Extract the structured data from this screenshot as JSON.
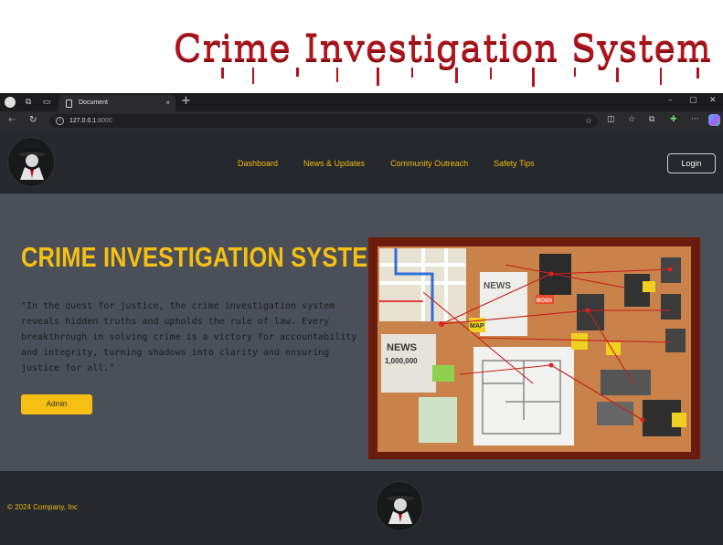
{
  "banner": {
    "title": "Crime Investigation System"
  },
  "browser": {
    "tab_title": "Document",
    "tab_close": "×",
    "new_tab": "+",
    "url_host": "127.0.0.1",
    "url_port": ":8000",
    "window_controls": [
      "–",
      "▢",
      "✕"
    ]
  },
  "site": {
    "nav": [
      "Dashboard",
      "News & Updates",
      "Community Outreach",
      "Safety Tips"
    ],
    "login_label": "Login",
    "hero_title": "CRIME INVESTIGATION SYSTEM",
    "hero_text": "\"In the quest for justice, the crime investigation system reveals hidden truths and upholds the rule of law. Every breakthrough in solving crime is a victory for accountability and integrity, turning shadows into clarity and ensuring justice for all.\"",
    "admin_label": "Admin",
    "footer_copyright": "© 2024 Company, Inc"
  },
  "board_labels": {
    "news": "NEWS",
    "stolen": "1,000,000",
    "map": "MAP",
    "boss": "BOSS",
    "news2": "NEWS"
  },
  "colors": {
    "accent": "#f5bf14",
    "header_bg": "#25282c",
    "body_bg": "#4b4f57",
    "banner_red": "#b3141c",
    "board_frame": "#6b1c0c"
  },
  "icons": [
    "profile-icon",
    "workspaces-icon",
    "tabs-icon",
    "document-icon",
    "back-icon",
    "refresh-icon",
    "info-icon",
    "favorite-star-icon",
    "split-screen-icon",
    "favorites-icon",
    "collections-icon",
    "extensions-icon",
    "more-icon",
    "copilot-icon",
    "detective-logo-icon"
  ]
}
